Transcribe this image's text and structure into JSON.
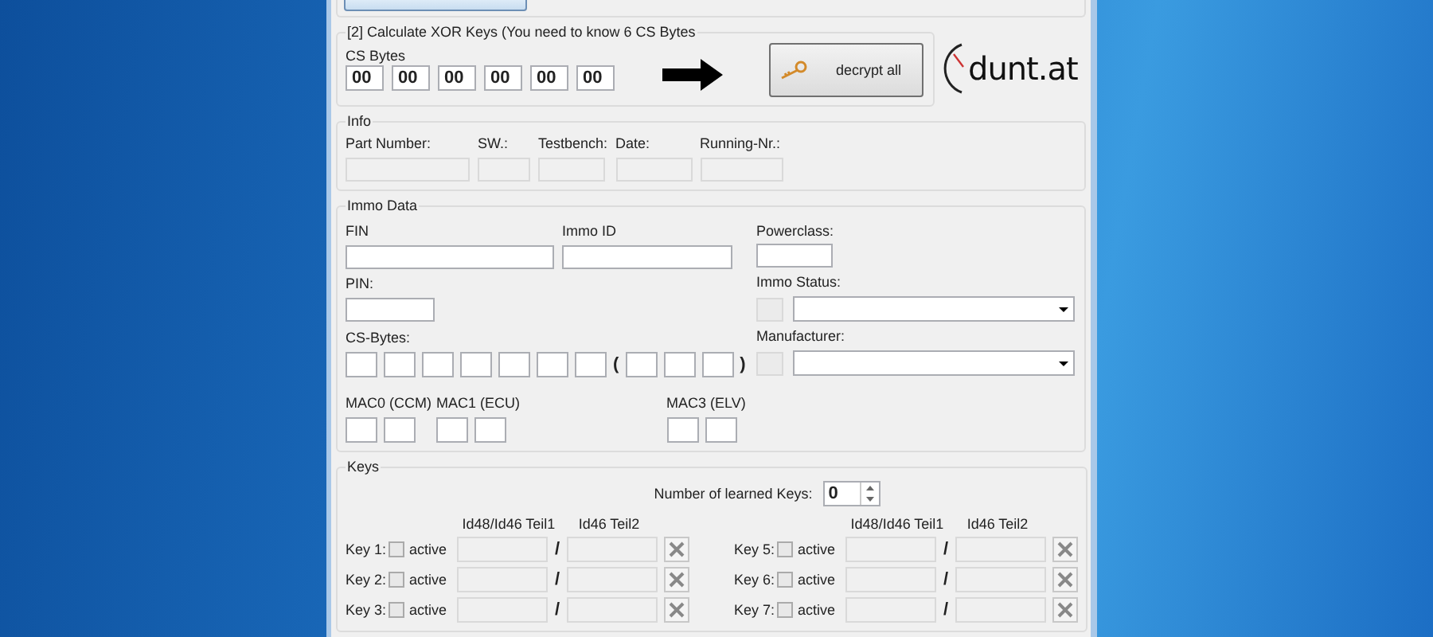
{
  "xor_group": {
    "title": "[2] Calculate XOR Keys (You need to know 6 CS Bytes",
    "cs_bytes_label": "CS Bytes",
    "cs_bytes": [
      "00",
      "00",
      "00",
      "00",
      "00",
      "00"
    ],
    "decrypt_button": "decrypt all"
  },
  "logo": {
    "text": "dunt.at"
  },
  "info": {
    "title": "Info",
    "fields": [
      {
        "label": "Part Number:"
      },
      {
        "label": "SW.:"
      },
      {
        "label": "Testbench:"
      },
      {
        "label": "Date:"
      },
      {
        "label": "Running-Nr.:"
      }
    ]
  },
  "immo_data": {
    "title": "Immo Data",
    "fin_label": "FIN",
    "immo_id_label": "Immo ID",
    "pin_label": "PIN:",
    "cs_bytes_label": "CS-Bytes:",
    "open_paren": "(",
    "close_paren": ")",
    "mac_labels": [
      "MAC0 (CCM)",
      "MAC1 (ECU)",
      "MAC3 (ELV)"
    ],
    "powerclass_label": "Powerclass:",
    "immo_status_label": "Immo Status:",
    "manufacturer_label": "Manufacturer:"
  },
  "keys": {
    "title": "Keys",
    "learned_label": "Number of learned Keys:",
    "learned_value": "0",
    "columns": [
      {
        "headers": [
          "Id48/Id46 Teil1",
          "Id46 Teil2"
        ],
        "keys": [
          {
            "label": "Key 1:",
            "active_label": "active",
            "checked": false,
            "separator": "/"
          },
          {
            "label": "Key 2:",
            "active_label": "active",
            "checked": false,
            "separator": "/"
          },
          {
            "label": "Key 3:",
            "active_label": "active",
            "checked": false,
            "separator": "/"
          }
        ]
      },
      {
        "headers": [
          "Id48/Id46 Teil1",
          "Id46 Teil2"
        ],
        "keys": [
          {
            "label": "Key 5:",
            "active_label": "active",
            "checked": false,
            "separator": "/"
          },
          {
            "label": "Key 6:",
            "active_label": "active",
            "checked": false,
            "separator": "/"
          },
          {
            "label": "Key 7:",
            "active_label": "active",
            "checked": false,
            "separator": "/"
          }
        ]
      }
    ]
  }
}
